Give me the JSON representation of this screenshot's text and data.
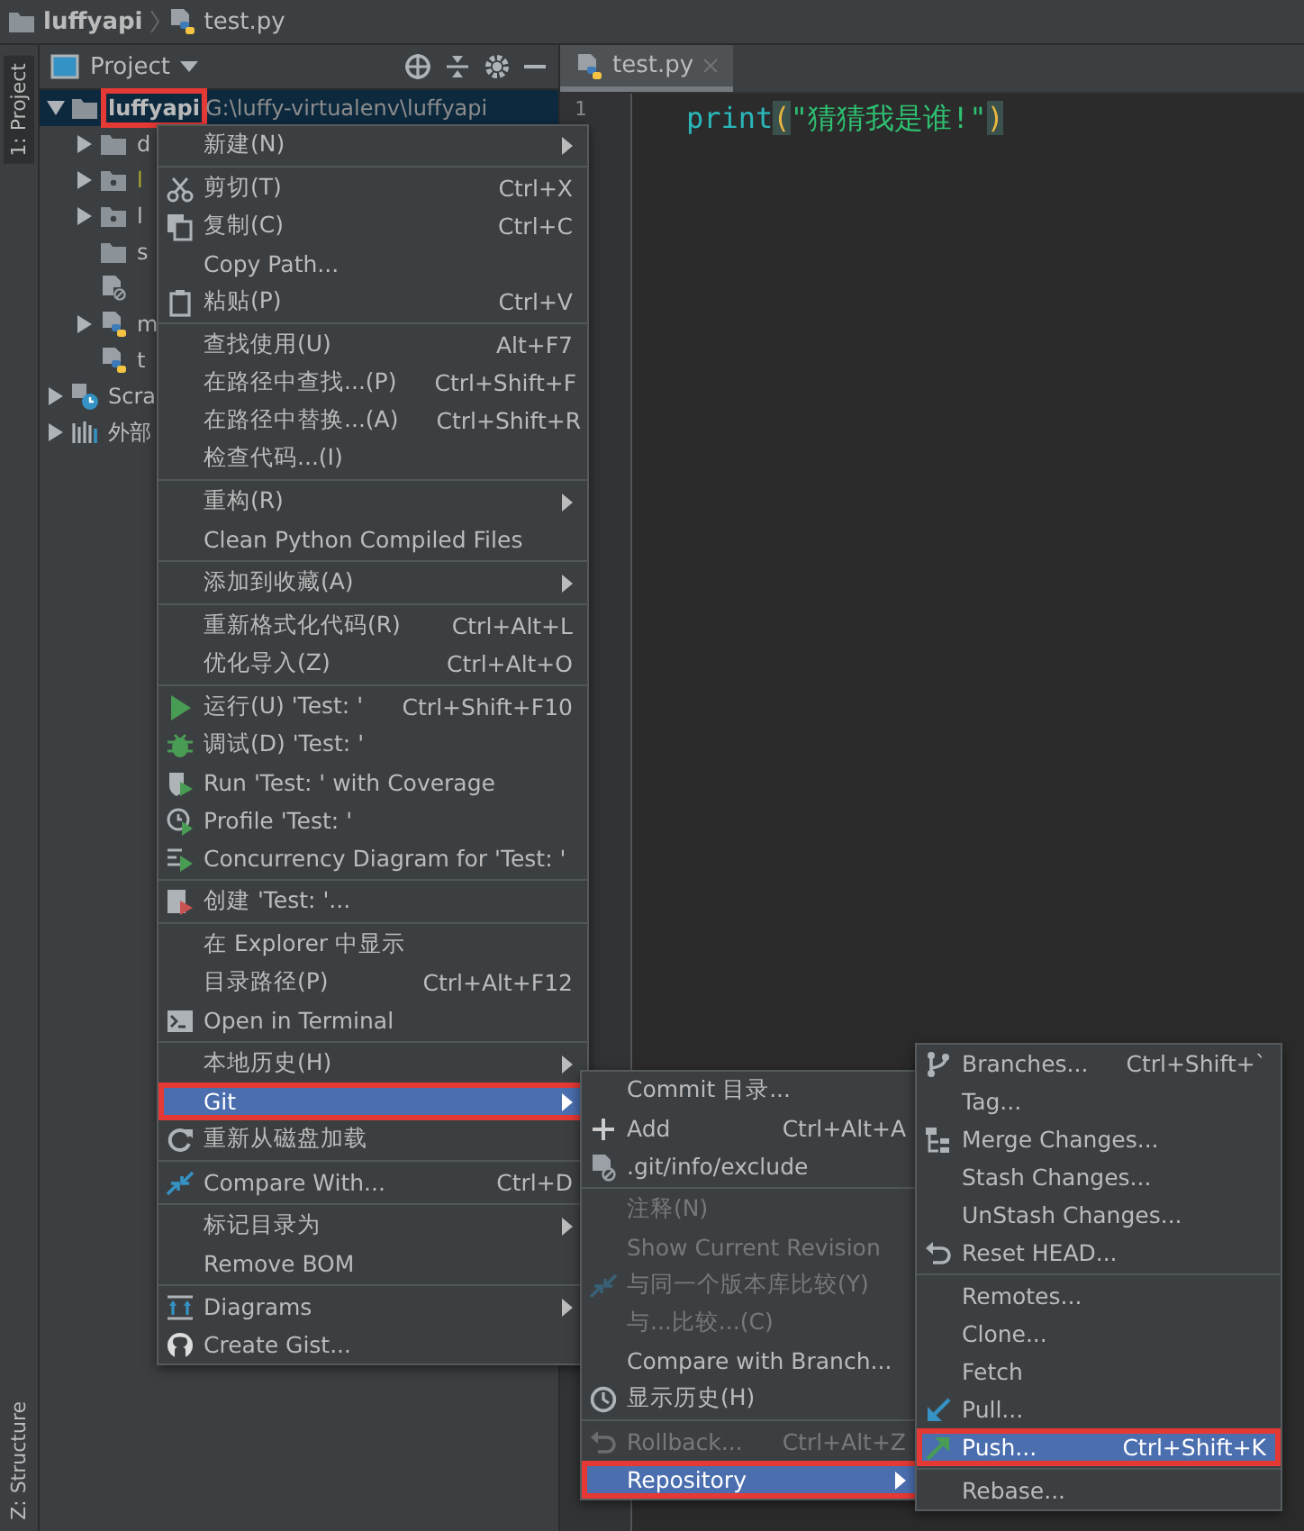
{
  "breadcrumb": [
    {
      "label": "luffyapi",
      "kind": "folder"
    },
    {
      "label": "test.py",
      "kind": "python"
    }
  ],
  "side_strip": {
    "top": "1: Project",
    "bottom": "Z: Structure"
  },
  "project_panel": {
    "title": "Project",
    "tree": [
      {
        "label": "luffyapi",
        "path": "G:\\luffy-virtualenv\\luffyapi",
        "kind": "folder",
        "expanded": true,
        "selected": true,
        "children": [
          {
            "label": "d",
            "kind": "folder",
            "expanded": false,
            "selected": false
          },
          {
            "label": "l",
            "kind": "package",
            "expanded": false,
            "selected": false,
            "excluded": true
          },
          {
            "label": "l",
            "kind": "package",
            "expanded": false,
            "selected": false
          },
          {
            "label": "s",
            "kind": "folder",
            "selected": false
          },
          {
            "kind": "ignored",
            "selected": false
          },
          {
            "label": "m",
            "kind": "python",
            "expanded": false,
            "selected": false
          },
          {
            "label": "t",
            "kind": "python",
            "selected": false
          }
        ]
      },
      {
        "label": "Scra",
        "kind": "scratch",
        "expanded": false,
        "selected": false
      },
      {
        "label": "外部",
        "kind": "library",
        "expanded": false,
        "selected": false
      }
    ]
  },
  "editor": {
    "tabs": [
      {
        "label": "test.py",
        "selected": true
      }
    ],
    "lines": [
      {
        "number": "1",
        "tokens": [
          {
            "text": "print",
            "kind": "builtin"
          },
          {
            "text": "(",
            "kind": "paren"
          },
          {
            "text": "\"猜猜我是谁!\"",
            "kind": "string"
          },
          {
            "text": ")",
            "kind": "paren"
          }
        ]
      }
    ]
  },
  "context_menu": {
    "groups": [
      [
        {
          "label": "新建(N)",
          "submenu": true,
          "selected": false
        }
      ],
      [
        {
          "label": "剪切(T)",
          "shortcut": "Ctrl+X",
          "kind": "scissors",
          "selected": false
        },
        {
          "label": "复制(C)",
          "shortcut": "Ctrl+C",
          "kind": "copy",
          "selected": false
        },
        {
          "label": "Copy Path...",
          "selected": false
        },
        {
          "label": "粘贴(P)",
          "shortcut": "Ctrl+V",
          "kind": "paste",
          "selected": false
        }
      ],
      [
        {
          "label": "查找使用(U)",
          "shortcut": "Alt+F7",
          "selected": false
        },
        {
          "label": "在路径中查找...(P)",
          "shortcut": "Ctrl+Shift+F",
          "selected": false
        },
        {
          "label": "在路径中替换...(A)",
          "shortcut": "Ctrl+Shift+R",
          "selected": false
        },
        {
          "label": "检查代码...(I)",
          "selected": false
        }
      ],
      [
        {
          "label": "重构(R)",
          "submenu": true,
          "selected": false
        },
        {
          "label": "Clean Python Compiled Files",
          "selected": false
        }
      ],
      [
        {
          "label": "添加到收藏(A)",
          "submenu": true,
          "selected": false
        }
      ],
      [
        {
          "label": "重新格式化代码(R)",
          "shortcut": "Ctrl+Alt+L",
          "selected": false
        },
        {
          "label": "优化导入(Z)",
          "shortcut": "Ctrl+Alt+O",
          "selected": false
        }
      ],
      [
        {
          "label": "运行(U) 'Test: '",
          "shortcut": "Ctrl+Shift+F10",
          "kind": "run",
          "selected": false
        },
        {
          "label": "调试(D) 'Test: '",
          "kind": "debug",
          "selected": false
        },
        {
          "label": "Run 'Test: ' with Coverage",
          "kind": "coverage",
          "selected": false
        },
        {
          "label": "Profile 'Test: '",
          "kind": "profile",
          "selected": false
        },
        {
          "label": "Concurrency Diagram for 'Test: '",
          "kind": "concurrency",
          "selected": false
        }
      ],
      [
        {
          "label": "创建 'Test: '...",
          "kind": "create",
          "selected": false
        }
      ],
      [
        {
          "label": "在 Explorer 中显示",
          "selected": false
        },
        {
          "label": "目录路径(P)",
          "shortcut": "Ctrl+Alt+F12",
          "selected": false
        },
        {
          "label": "Open in Terminal",
          "kind": "terminal",
          "selected": false
        }
      ],
      [
        {
          "label": "本地历史(H)",
          "submenu": true,
          "selected": false
        },
        {
          "label": "Git",
          "submenu": true,
          "selected": true
        },
        {
          "label": "重新从磁盘加载",
          "kind": "reload",
          "selected": false
        }
      ],
      [
        {
          "label": "Compare With...",
          "shortcut": "Ctrl+D",
          "kind": "compare",
          "selected": false
        }
      ],
      [
        {
          "label": "标记目录为",
          "submenu": true,
          "selected": false
        },
        {
          "label": "Remove BOM",
          "selected": false
        }
      ],
      [
        {
          "label": "Diagrams",
          "submenu": true,
          "kind": "diagram",
          "selected": false
        },
        {
          "label": "Create Gist...",
          "kind": "github",
          "selected": false
        }
      ]
    ]
  },
  "git_menu": {
    "groups": [
      [
        {
          "label": "Commit 目录...",
          "disabled": false,
          "selected": false
        },
        {
          "label": "Add",
          "shortcut": "Ctrl+Alt+A",
          "kind": "plus",
          "disabled": false,
          "selected": false
        },
        {
          "label": ".git/info/exclude",
          "kind": "ignored",
          "disabled": false,
          "selected": false
        }
      ],
      [
        {
          "label": "注释(N)",
          "disabled": true,
          "selected": false
        },
        {
          "label": "Show Current Revision",
          "disabled": true,
          "selected": false
        },
        {
          "label": "与同一个版本库比较(Y)",
          "kind": "compare",
          "disabled": true,
          "selected": false
        },
        {
          "label": "与...比较...(C)",
          "disabled": true,
          "selected": false
        },
        {
          "label": "Compare with Branch...",
          "disabled": false,
          "selected": false
        },
        {
          "label": "显示历史(H)",
          "kind": "clock",
          "disabled": false,
          "selected": false
        }
      ],
      [
        {
          "label": "Rollback...",
          "shortcut": "Ctrl+Alt+Z",
          "kind": "undo",
          "disabled": true,
          "selected": false
        },
        {
          "label": "Repository",
          "submenu": true,
          "disabled": false,
          "selected": true
        }
      ]
    ]
  },
  "repository_menu": {
    "groups": [
      [
        {
          "label": "Branches...",
          "shortcut": "Ctrl+Shift+`",
          "kind": "branch",
          "selected": false
        },
        {
          "label": "Tag...",
          "selected": false
        },
        {
          "label": "Merge Changes...",
          "kind": "merge",
          "selected": false
        },
        {
          "label": "Stash Changes...",
          "selected": false
        },
        {
          "label": "UnStash Changes...",
          "selected": false
        },
        {
          "label": "Reset HEAD...",
          "kind": "undo",
          "selected": false
        }
      ],
      [
        {
          "label": "Remotes...",
          "selected": false
        },
        {
          "label": "Clone...",
          "selected": false
        },
        {
          "label": "Fetch",
          "selected": false
        },
        {
          "label": "Pull...",
          "kind": "pull",
          "selected": false
        },
        {
          "label": "Push...",
          "shortcut": "Ctrl+Shift+K",
          "kind": "push",
          "selected": true
        }
      ],
      [
        {
          "label": "Rebase...",
          "selected": false
        }
      ]
    ]
  }
}
